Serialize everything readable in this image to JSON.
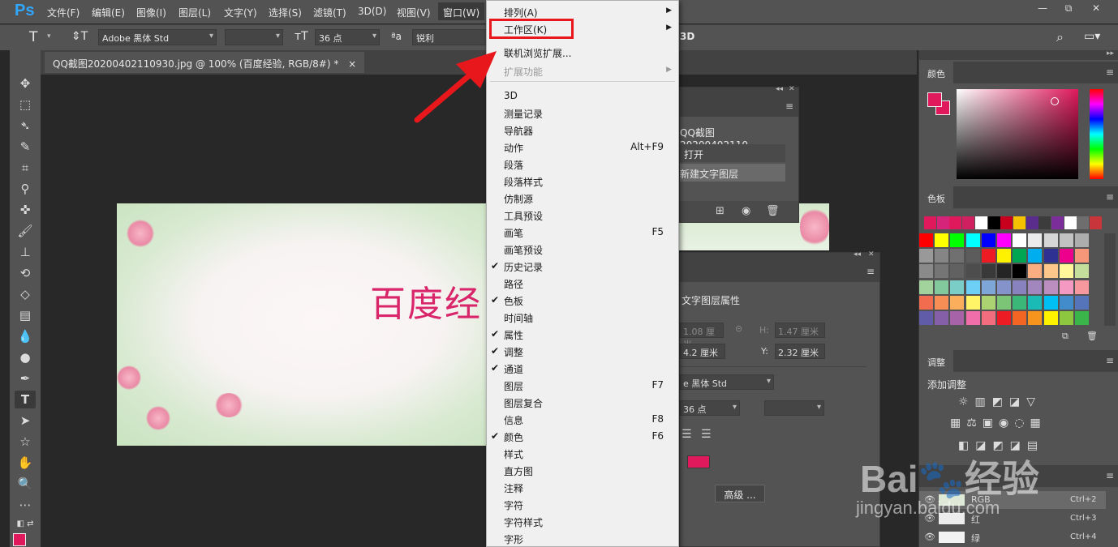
{
  "menubar": {
    "logo": "Ps",
    "items": [
      "文件(F)",
      "编辑(E)",
      "图像(I)",
      "图层(L)",
      "文字(Y)",
      "选择(S)",
      "滤镜(T)",
      "3D(D)",
      "视图(V)",
      "窗口(W)"
    ],
    "window_controls": [
      "—",
      "⧉",
      "✕"
    ]
  },
  "options_bar": {
    "type_tool_icon": "T",
    "font_family": "Adobe 黑体 Std",
    "font_size": "36 点",
    "aa_label": "ªa",
    "anti_alias": "锐利",
    "mode_3d": "3D"
  },
  "document": {
    "tab_title": "QQ截图20200402110930.jpg @ 100% (百度经验, RGB/8#) *",
    "tab_close": "×",
    "canvas_text": "百度经"
  },
  "window_menu": {
    "top_items": [
      {
        "label": "排列(A)",
        "submenu": true
      },
      {
        "label": "工作区(K)",
        "submenu": true,
        "highlighted": true
      },
      {
        "label": "联机浏览扩展...",
        "submenu": false
      },
      {
        "label": "扩展功能",
        "submenu": true,
        "disabled": true
      }
    ],
    "panel_items": [
      {
        "label": "3D",
        "checked": false,
        "shortcut": ""
      },
      {
        "label": "测量记录",
        "checked": false,
        "shortcut": ""
      },
      {
        "label": "导航器",
        "checked": false,
        "shortcut": ""
      },
      {
        "label": "动作",
        "checked": false,
        "shortcut": "Alt+F9"
      },
      {
        "label": "段落",
        "checked": false,
        "shortcut": ""
      },
      {
        "label": "段落样式",
        "checked": false,
        "shortcut": ""
      },
      {
        "label": "仿制源",
        "checked": false,
        "shortcut": ""
      },
      {
        "label": "工具预设",
        "checked": false,
        "shortcut": ""
      },
      {
        "label": "画笔",
        "checked": false,
        "shortcut": "F5"
      },
      {
        "label": "画笔预设",
        "checked": false,
        "shortcut": ""
      },
      {
        "label": "历史记录",
        "checked": true,
        "shortcut": ""
      },
      {
        "label": "路径",
        "checked": false,
        "shortcut": ""
      },
      {
        "label": "色板",
        "checked": true,
        "shortcut": ""
      },
      {
        "label": "时间轴",
        "checked": false,
        "shortcut": ""
      },
      {
        "label": "属性",
        "checked": true,
        "shortcut": ""
      },
      {
        "label": "调整",
        "checked": true,
        "shortcut": ""
      },
      {
        "label": "通道",
        "checked": true,
        "shortcut": ""
      },
      {
        "label": "图层",
        "checked": false,
        "shortcut": "F7"
      },
      {
        "label": "图层复合",
        "checked": false,
        "shortcut": ""
      },
      {
        "label": "信息",
        "checked": false,
        "shortcut": "F8"
      },
      {
        "label": "颜色",
        "checked": true,
        "shortcut": "F6"
      },
      {
        "label": "样式",
        "checked": false,
        "shortcut": ""
      },
      {
        "label": "直方图",
        "checked": false,
        "shortcut": ""
      },
      {
        "label": "注释",
        "checked": false,
        "shortcut": ""
      },
      {
        "label": "字符",
        "checked": false,
        "shortcut": ""
      },
      {
        "label": "字符样式",
        "checked": false,
        "shortcut": ""
      },
      {
        "label": "字形",
        "checked": false,
        "shortcut": ""
      }
    ],
    "check_glyph": "✔",
    "arrow_glyph": "▶"
  },
  "history_panel": {
    "snapshot": "QQ截图20200402110...",
    "items": [
      "打开",
      "新建文字图层"
    ]
  },
  "properties_panel": {
    "title": "文字图层属性",
    "w_value": "1.08 厘米",
    "h_label": "H:",
    "h_value": "1.47 厘米",
    "x_value": "4.2 厘米",
    "y_label": "Y:",
    "y_value": "2.32 厘米",
    "font": "e 黑体 Std",
    "size": "36 点",
    "advanced_button": "高级 ..."
  },
  "right_dock": {
    "color_tab": "颜色",
    "swatches_tab": "色板",
    "adjust_tab": "调整",
    "adjust_subtitle": "添加调整",
    "channels": [
      {
        "name": "RGB",
        "shortcut": "Ctrl+2"
      },
      {
        "name": "红",
        "shortcut": "Ctrl+3"
      },
      {
        "name": "绿",
        "shortcut": "Ctrl+4"
      }
    ],
    "foreground_color": "#e0195d",
    "background_color": "#e0195d"
  },
  "swatch_colors": {
    "recent": [
      "#e0195d",
      "#d5247a",
      "#e0195d",
      "#d1205f",
      "#ffffff",
      "#000000",
      "#c8001e",
      "#f5c200",
      "#5a2d8c",
      "#3c3c3c",
      "#7b2e9a",
      "#ffffff",
      "#6e6e6e",
      "#c8353a"
    ],
    "grid": [
      "#ff0000",
      "#ffff00",
      "#00ff00",
      "#00ffff",
      "#0000ff",
      "#ff00ff",
      "#ffffff",
      "#ebebeb",
      "#d6d6d6",
      "#c2c2c2",
      "#adadad",
      "#999999",
      "#858585",
      "#707070",
      "#5c5c5c",
      "#ed1c24",
      "#fff200",
      "#00a651",
      "#00aeef",
      "#2e3192",
      "#ec008c",
      "#f7977a",
      "#8a8a8a",
      "#757575",
      "#616161",
      "#4d4d4d",
      "#393939",
      "#252525",
      "#000000",
      "#f9ad81",
      "#fdc68a",
      "#fff79a",
      "#c4df9b",
      "#a3d39c",
      "#82ca9d",
      "#7bcdc8",
      "#6ecff6",
      "#7ea7d8",
      "#8493ca",
      "#8882be",
      "#a187be",
      "#bc8dbf",
      "#f49ac2",
      "#f6989d",
      "#f26c4f",
      "#f68e55",
      "#fbaf5c",
      "#fff467",
      "#acd372",
      "#7cc576",
      "#3bb878",
      "#1abbb4",
      "#00bff3",
      "#438ccb",
      "#5574b9",
      "#605ca8",
      "#855fa8",
      "#a763a8",
      "#f06ea9",
      "#f26d7d",
      "#ed1c24",
      "#f26522",
      "#f7941d",
      "#fff200",
      "#8dc63f",
      "#39b54a"
    ]
  }
}
